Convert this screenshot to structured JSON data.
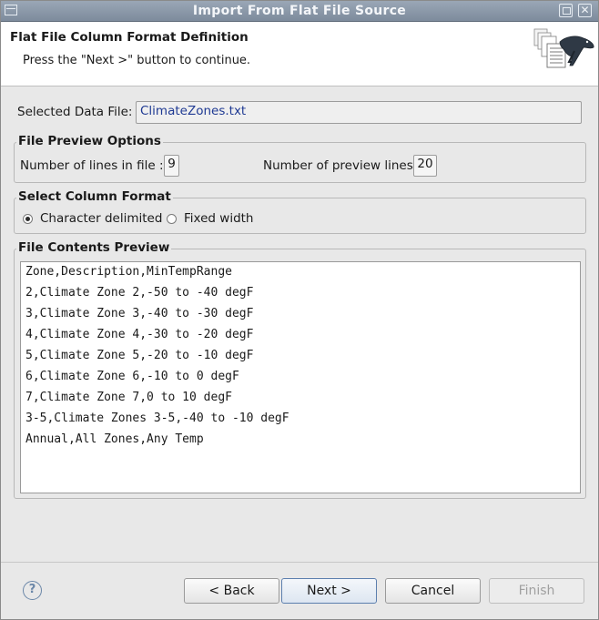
{
  "window": {
    "title": "Import From Flat File Source"
  },
  "header": {
    "title": "Flat File Column Format Definition",
    "description": "Press the \"Next >\" button to continue."
  },
  "data_file": {
    "label": "Selected Data File:",
    "value": "ClimateZones.txt"
  },
  "preview_options": {
    "legend": "File Preview Options",
    "lines_in_file_label": "Number of lines in file :",
    "lines_in_file_value": "9",
    "preview_lines_label": "Number of preview lines",
    "preview_lines_value": "20"
  },
  "column_format": {
    "legend": "Select Column Format",
    "option_delimited": "Character delimited",
    "option_fixed": "Fixed width",
    "selected": "Character delimited"
  },
  "contents_preview": {
    "legend": "File Contents Preview",
    "lines": [
      "Zone,Description,MinTempRange",
      "2,Climate Zone 2,-50 to -40 degF",
      "3,Climate Zone 3,-40 to -30 degF",
      "4,Climate Zone 4,-30 to -20 degF",
      "5,Climate Zone 5,-20 to -10 degF",
      "6,Climate Zone 6,-10 to 0 degF",
      "7,Climate Zone 7,0 to 10 degF",
      "3-5,Climate Zones 3-5,-40 to -10 degF",
      "Annual,All Zones,Any Temp"
    ]
  },
  "buttons": {
    "help": "?",
    "back": "< Back",
    "next": "Next >",
    "cancel": "Cancel",
    "finish": "Finish"
  },
  "icons": {
    "close": "close-icon",
    "maximize": "maximize-icon",
    "system_menu": "window-menu-icon",
    "help": "help-icon"
  }
}
